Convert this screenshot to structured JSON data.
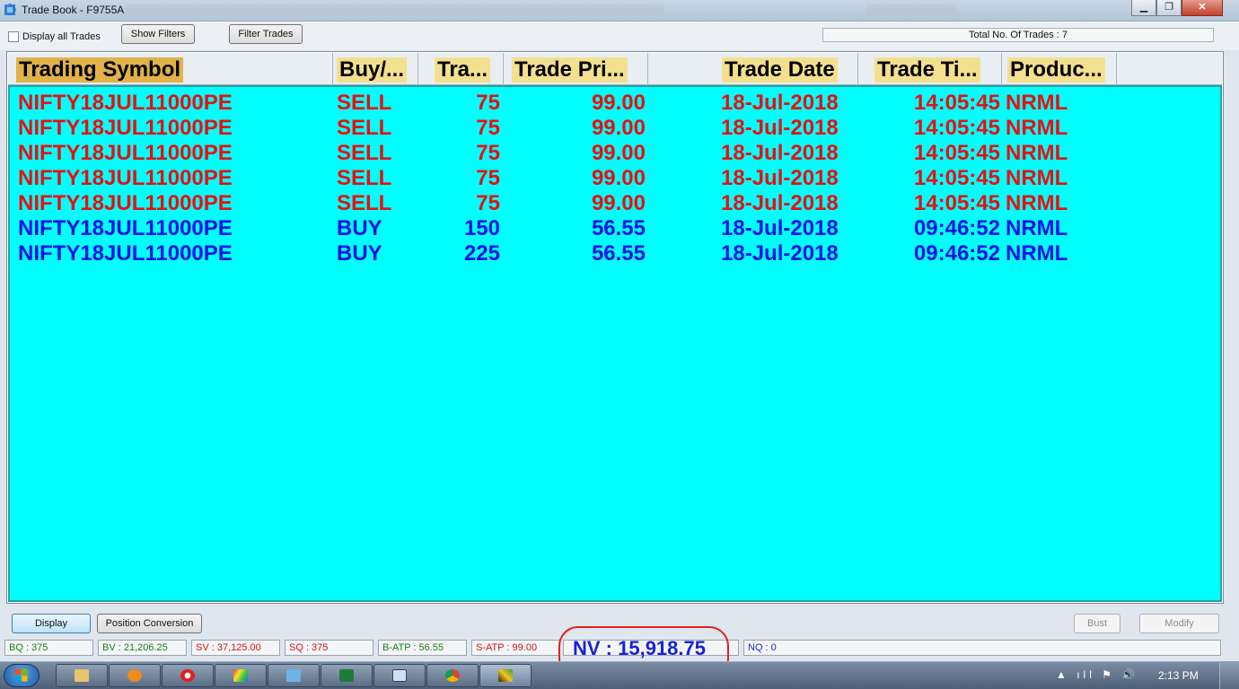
{
  "window": {
    "title": "Trade Book - F9755A",
    "controls": {
      "minimize": "▁",
      "maximize": "❐",
      "close": "✕"
    }
  },
  "toolbar": {
    "display_all_label": "Display all Trades",
    "show_filters": "Show Filters",
    "filter_trades": "Filter Trades",
    "total_trades": "Total No. Of Trades : 7"
  },
  "grid": {
    "headers": [
      "Trading Symbol",
      "Buy/...",
      "Tra...",
      "Trade Pri...",
      "Trade Date",
      "Trade Ti...",
      "Produc..."
    ],
    "rows": [
      {
        "symbol": "NIFTY18JUL11000PE",
        "side": "SELL",
        "qty": "75",
        "price": "99.00",
        "date": "18-Jul-2018",
        "time": "14:05:45",
        "product": "NRML"
      },
      {
        "symbol": "NIFTY18JUL11000PE",
        "side": "SELL",
        "qty": "75",
        "price": "99.00",
        "date": "18-Jul-2018",
        "time": "14:05:45",
        "product": "NRML"
      },
      {
        "symbol": "NIFTY18JUL11000PE",
        "side": "SELL",
        "qty": "75",
        "price": "99.00",
        "date": "18-Jul-2018",
        "time": "14:05:45",
        "product": "NRML"
      },
      {
        "symbol": "NIFTY18JUL11000PE",
        "side": "SELL",
        "qty": "75",
        "price": "99.00",
        "date": "18-Jul-2018",
        "time": "14:05:45",
        "product": "NRML"
      },
      {
        "symbol": "NIFTY18JUL11000PE",
        "side": "SELL",
        "qty": "75",
        "price": "99.00",
        "date": "18-Jul-2018",
        "time": "14:05:45",
        "product": "NRML"
      },
      {
        "symbol": "NIFTY18JUL11000PE",
        "side": "BUY",
        "qty": "150",
        "price": "56.55",
        "date": "18-Jul-2018",
        "time": "09:46:52",
        "product": "NRML"
      },
      {
        "symbol": "NIFTY18JUL11000PE",
        "side": "BUY",
        "qty": "225",
        "price": "56.55",
        "date": "18-Jul-2018",
        "time": "09:46:52",
        "product": "NRML"
      }
    ]
  },
  "actions": {
    "display": "Display",
    "position_conversion": "Position Conversion",
    "bust": "Bust",
    "modify": "Modify"
  },
  "status": {
    "bq": "BQ : 375",
    "bv": "BV : 21,206.25",
    "sv": "SV : 37,125.00",
    "sq": "SQ : 375",
    "batp": "B-ATP : 56.55",
    "satp": "S-ATP : 99.00",
    "nv": "NV : 15,918.75",
    "nq": "NQ : 0"
  },
  "taskbar": {
    "tray_icons": "▲ ıll ⚑ 🔊",
    "clock": "2:13 PM"
  },
  "colors": {
    "grid_background": "#00ffff",
    "sell": "#e81010",
    "buy": "#0a12e8",
    "header_label": "#f3e08f",
    "header_selected": "#e1b24a"
  },
  "icons": [
    "app-puzzle-icon",
    "explorer-icon",
    "media-player-icon",
    "lifebuoy-icon",
    "prism-icon",
    "folder-icon",
    "excel-icon",
    "window-icon",
    "chrome-icon",
    "trading-app-icon"
  ]
}
